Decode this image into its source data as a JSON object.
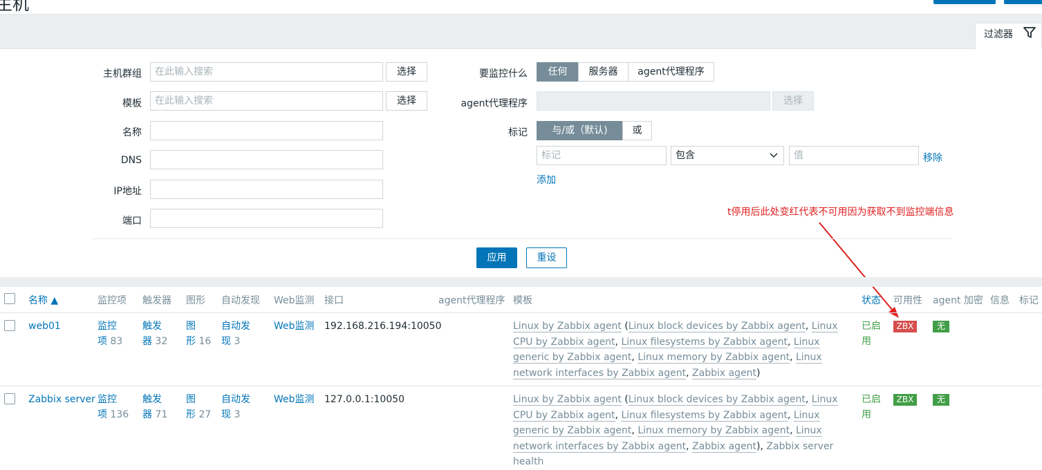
{
  "page": {
    "title": "主机"
  },
  "filter": {
    "tab_label": "过滤器",
    "host_group": {
      "label": "主机群组",
      "placeholder": "在此输入搜索",
      "select": "选择"
    },
    "template": {
      "label": "模板",
      "placeholder": "在此输入搜索",
      "select": "选择"
    },
    "name": {
      "label": "名称",
      "value": ""
    },
    "dns": {
      "label": "DNS",
      "value": ""
    },
    "ip": {
      "label": "IP地址",
      "value": ""
    },
    "port": {
      "label": "端口",
      "value": ""
    },
    "monitored_by": {
      "label": "要监控什么",
      "options": [
        "任何",
        "服务器",
        "agent代理程序"
      ],
      "selected": "任何"
    },
    "proxy": {
      "label": "agent代理程序",
      "select": "选择"
    },
    "tags": {
      "label": "标记",
      "options": [
        "与/或（默认)",
        "或"
      ],
      "tag_placeholder": "标记",
      "operator": "包含",
      "value_placeholder": "值",
      "remove": "移除",
      "add": "添加"
    },
    "apply": "应用",
    "reset": "重设"
  },
  "annotation": {
    "text": "t停用后此处变红代表不可用因为获取不到监控端信息",
    "color": "#e02020"
  },
  "table": {
    "headers": {
      "name": "名称 ▲",
      "items": "监控项",
      "triggers": "触发器",
      "graphs": "图形",
      "discovery": "自动发现",
      "web": "Web监测",
      "interface": "接口",
      "proxy": "agent代理程序",
      "templates": "模板",
      "status": "状态",
      "availability": "可用性",
      "encryption": "agent 加密",
      "info": "信息",
      "tags": "标记"
    },
    "rows": [
      {
        "name": "web01",
        "items_a": "监控",
        "items_b": "项",
        "items_count": "83",
        "triggers_a": "触发",
        "triggers_b": "器",
        "triggers_count": "32",
        "graphs_a": "图",
        "graphs_b": "形",
        "graphs_count": "16",
        "discovery_a": "自动发",
        "discovery_b": "现",
        "discovery_count": "3",
        "web": "Web监测",
        "interface": "192.168.216.194:10050",
        "tmpl_main": "Linux by Zabbix agent",
        "tmpl_1": "Linux block devices by Zabbix agent",
        "tmpl_2": "Linux CPU by Zabbix agent",
        "tmpl_3": "Linux filesystems by Zabbix agent",
        "tmpl_4": "Linux generic by Zabbix agent",
        "tmpl_5": "Linux memory by Zabbix agent",
        "tmpl_6": "Linux network interfaces by Zabbix agent",
        "tmpl_7": "Zabbix agent",
        "tmpl_extra": "",
        "status_a": "已启",
        "status_b": "用",
        "zbx": "ZBX",
        "zbx_color": "#d64e4e",
        "encryption": "无"
      },
      {
        "name": "Zabbix server",
        "items_a": "监控",
        "items_b": "项",
        "items_count": "136",
        "triggers_a": "触发",
        "triggers_b": "器",
        "triggers_count": "71",
        "graphs_a": "图",
        "graphs_b": "形",
        "graphs_count": "27",
        "discovery_a": "自动发",
        "discovery_b": "现",
        "discovery_count": "3",
        "web": "Web监测",
        "interface": "127.0.0.1:10050",
        "tmpl_main": "Linux by Zabbix agent",
        "tmpl_1": "Linux block devices by Zabbix agent",
        "tmpl_2": "Linux CPU by Zabbix agent",
        "tmpl_3": "Linux filesystems by Zabbix agent",
        "tmpl_4": "Linux generic by Zabbix agent",
        "tmpl_5": "Linux memory by Zabbix agent",
        "tmpl_6": "Linux network interfaces by Zabbix agent",
        "tmpl_7": "Zabbix agent",
        "tmpl_extra": "Zabbix server health",
        "status_a": "已启",
        "status_b": "用",
        "zbx": "ZBX",
        "zbx_color": "#429e47",
        "encryption": "无"
      }
    ]
  },
  "colors": {
    "primary": "#0275b8",
    "enabled": "#429e47",
    "unavailable": "#d64e4e",
    "badge_none": "#429e47"
  }
}
